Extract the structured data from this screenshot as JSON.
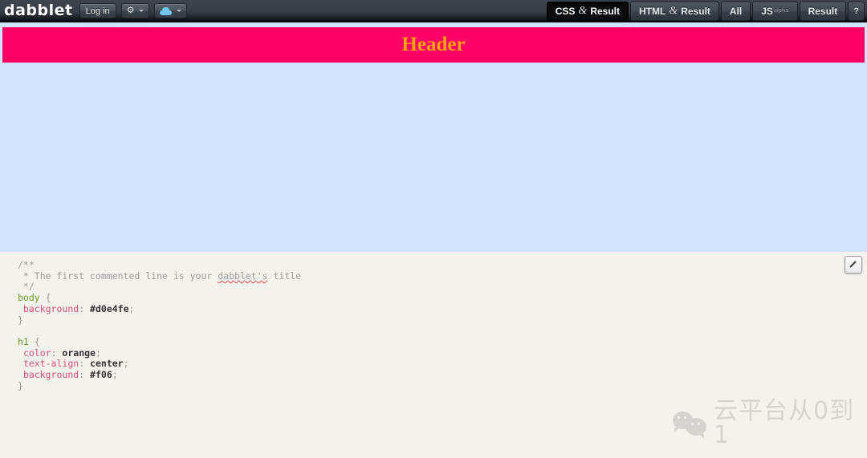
{
  "app": {
    "logo_text": "dabblet"
  },
  "toolbar": {
    "login_label": "Log in",
    "settings_icon": "gear-icon",
    "save_icon": "cloud-icon",
    "tabs": [
      {
        "id": "css-result",
        "left": "CSS",
        "amp": "&",
        "right": "Result",
        "active": true
      },
      {
        "id": "html-result",
        "left": "HTML",
        "amp": "&",
        "right": "Result",
        "active": false
      },
      {
        "id": "all",
        "left": "All",
        "amp": "",
        "right": "",
        "active": false
      },
      {
        "id": "js",
        "left": "JS",
        "amp": "",
        "right": "",
        "sub": "alpha",
        "active": false
      },
      {
        "id": "result",
        "left": "Result",
        "amp": "",
        "right": "",
        "active": false
      }
    ],
    "help_label": "?"
  },
  "result": {
    "header_text": "Header",
    "background_color": "#d0e4fe",
    "header_background": "#ff0066",
    "header_color": "orange"
  },
  "editor": {
    "pencil_icon": "pencil-icon",
    "code_lines": [
      "/**",
      " * The first commented line is your dabblet's title",
      " */",
      "body {",
      "  background: #d0e4fe;",
      "}",
      "",
      "h1 {",
      "  color: orange;",
      "  text-align: center;",
      "  background: #f06;",
      "}"
    ],
    "comment_line_prefix": " * The first commented line is your ",
    "comment_spell_word": "dabblet's",
    "comment_line_suffix": " title",
    "selectors": {
      "body": "body",
      "h1": "h1"
    },
    "declarations": [
      {
        "prop": "background",
        "value": "#d0e4fe"
      },
      {
        "prop": "color",
        "value": "orange"
      },
      {
        "prop": "text-align",
        "value": "center"
      },
      {
        "prop": "background",
        "value": "#f06"
      }
    ]
  },
  "watermark": {
    "text": "云平台从0到1",
    "icon": "wechat-icon"
  }
}
